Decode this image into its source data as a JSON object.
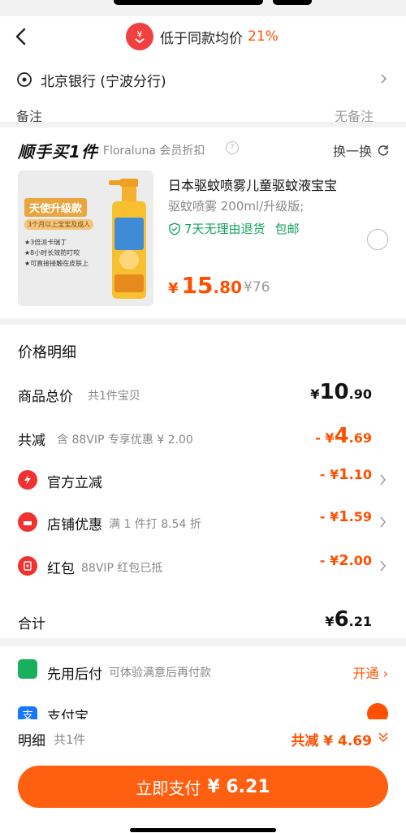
{
  "header": {
    "title": "低于同款均价",
    "percent": "21%"
  },
  "address": {
    "text": "北京银行 (宁波分行)",
    "cut_left": "备注",
    "cut_right": "无备注"
  },
  "product_card": {
    "brand": "顺手买1件",
    "brand_sub": "· Floraluna 会员折扣",
    "swap_label": "换一换",
    "title": "日本驱蚊喷雾儿童驱蚊液宝宝",
    "spec": "驱蚊喷雾 200ml/升级版;",
    "return_tag": "7天无理由退货",
    "shipping_tag": "包邮",
    "price_currency": "¥",
    "price_int": "15",
    "price_dec": ".80",
    "price_original": "¥76",
    "image": {
      "tag": "天使升级款",
      "sub": "3个月以上宝宝及成人",
      "bullets": [
        "★3倍派卡瑞丁",
        "★8小时长效防叮咬",
        "★可直接接触在皮肤上"
      ]
    }
  },
  "price_detail": {
    "title": "价格明细",
    "rows": [
      {
        "label": "商品总价",
        "note": "共1件宝贝",
        "sign": "¥",
        "int": "10",
        "dec": ".90"
      },
      {
        "label": "共减",
        "note": "含 88VIP 专享优惠 ¥ 2.00",
        "sign": "- ¥",
        "int": "4",
        "dec": ".69"
      },
      {
        "label": "官方立减",
        "note": "",
        "sign": "- ¥",
        "int": "1",
        "dec": ".10"
      },
      {
        "label": "店铺优惠",
        "note": "满 1 件打 8.54 折",
        "sign": "- ¥",
        "int": "1",
        "dec": ".59"
      },
      {
        "label": "红包",
        "note": "88VIP 红包已抵",
        "sign": "- ¥",
        "int": "2",
        "dec": ".00"
      },
      {
        "label": "合计",
        "note": "",
        "sign": "¥",
        "int": "6",
        "dec": ".21"
      }
    ]
  },
  "payment": {
    "credit_label": "先用后付",
    "credit_note": "可体验满意后再付款",
    "credit_action": "开通",
    "alipay_label": "支付宝",
    "alipay_icon": "支"
  },
  "footer": {
    "label": "明细",
    "count": "共1件",
    "savings": "共减 ¥ 4.69",
    "pay_label": "立即支付",
    "pay_amount": "¥ 6.21"
  },
  "colors": {
    "accent": "#ff5000",
    "green": "#16a35c",
    "red": "#f0312f"
  }
}
